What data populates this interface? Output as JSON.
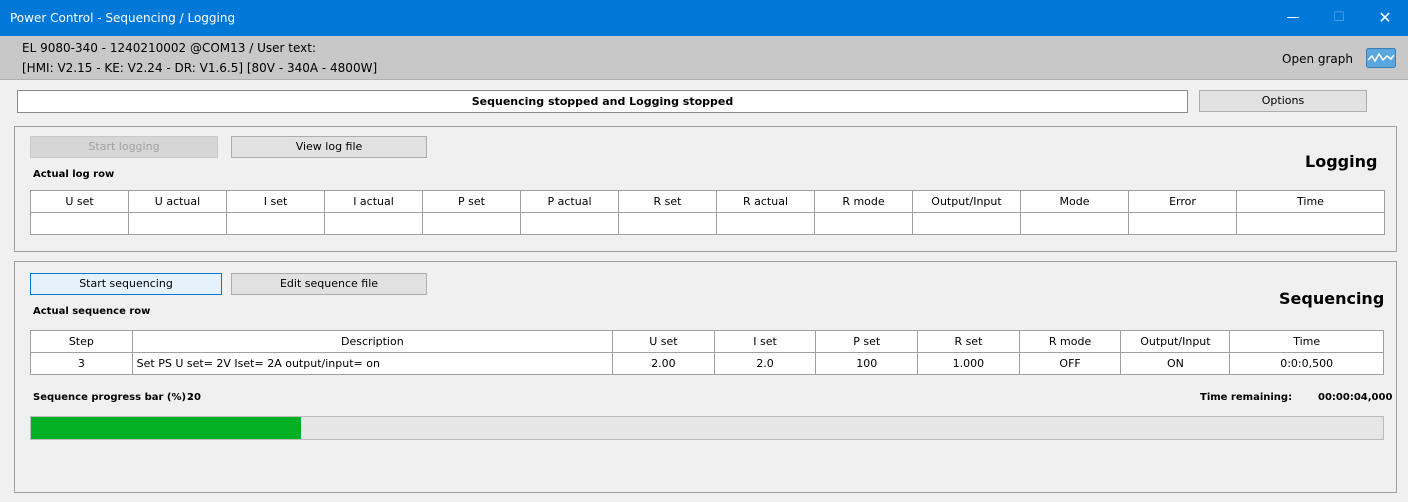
{
  "window": {
    "title": "Power Control - Sequencing / Logging",
    "minimize_glyph": "—",
    "maximize_glyph": "☐",
    "close_glyph": "✕"
  },
  "device": {
    "line1": "EL 9080-340 - 1240210002 @COM13 / User text:",
    "line2": "[HMI: V2.15 - KE: V2.24 - DR: V1.6.5] [80V - 340A - 4800W]"
  },
  "open_graph": {
    "label": "Open graph",
    "icon": "graph-wave-icon"
  },
  "status": {
    "text": "Sequencing stopped and Logging stopped"
  },
  "options": {
    "label": "Options"
  },
  "logging": {
    "title": "Logging",
    "start_label": "Start logging",
    "view_label": "View log file",
    "caption": "Actual log row",
    "columns": [
      "U set",
      "U actual",
      "I set",
      "I actual",
      "P set",
      "P actual",
      "R set",
      "R actual",
      "R mode",
      "Output/Input",
      "Mode",
      "Error",
      "Time"
    ],
    "row": [
      "",
      "",
      "",
      "",
      "",
      "",
      "",
      "",
      "",
      "",
      "",
      "",
      ""
    ]
  },
  "sequencing": {
    "title": "Sequencing",
    "start_label": "Start sequencing",
    "edit_label": "Edit sequence file",
    "caption": "Actual sequence row",
    "columns": [
      "Step",
      "Description",
      "U set",
      "I set",
      "P set",
      "R set",
      "R mode",
      "Output/Input",
      "Time"
    ],
    "row": [
      "3",
      "Set PS U set= 2V Iset= 2A output/input= on",
      "2.00",
      "2.0",
      "100",
      "1.000",
      "OFF",
      "ON",
      "0:0:0,500"
    ],
    "progress_label": "Sequence progress bar (%) :",
    "progress_value": "20",
    "progress_percent": 20,
    "time_remaining_label": "Time remaining:",
    "time_remaining_value": "00:00:04,000"
  },
  "colors": {
    "titlebar": "#0078d7",
    "progress": "#06b025"
  }
}
